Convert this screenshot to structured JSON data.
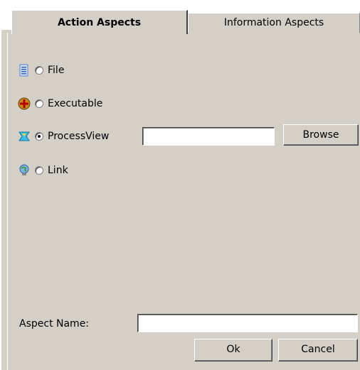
{
  "tabs": [
    {
      "label": "Action Aspects",
      "active": true
    },
    {
      "label": "Information Aspects",
      "active": false
    }
  ],
  "options": [
    {
      "label": "File",
      "icon": "document-icon",
      "selected": false
    },
    {
      "label": "Executable",
      "icon": "executable-icon",
      "selected": false
    },
    {
      "label": "ProcessView",
      "icon": "process-view-icon",
      "selected": true
    },
    {
      "label": "Link",
      "icon": "link-globe-icon",
      "selected": false
    }
  ],
  "processview": {
    "value": "",
    "browse_label": "Browse"
  },
  "aspect_name": {
    "label": "Aspect Name:",
    "value": ""
  },
  "buttons": {
    "ok": "Ok",
    "cancel": "Cancel"
  },
  "colors": {
    "dialog_bg": "#d4d0c8",
    "accent_blue": "#2f6fd6"
  }
}
